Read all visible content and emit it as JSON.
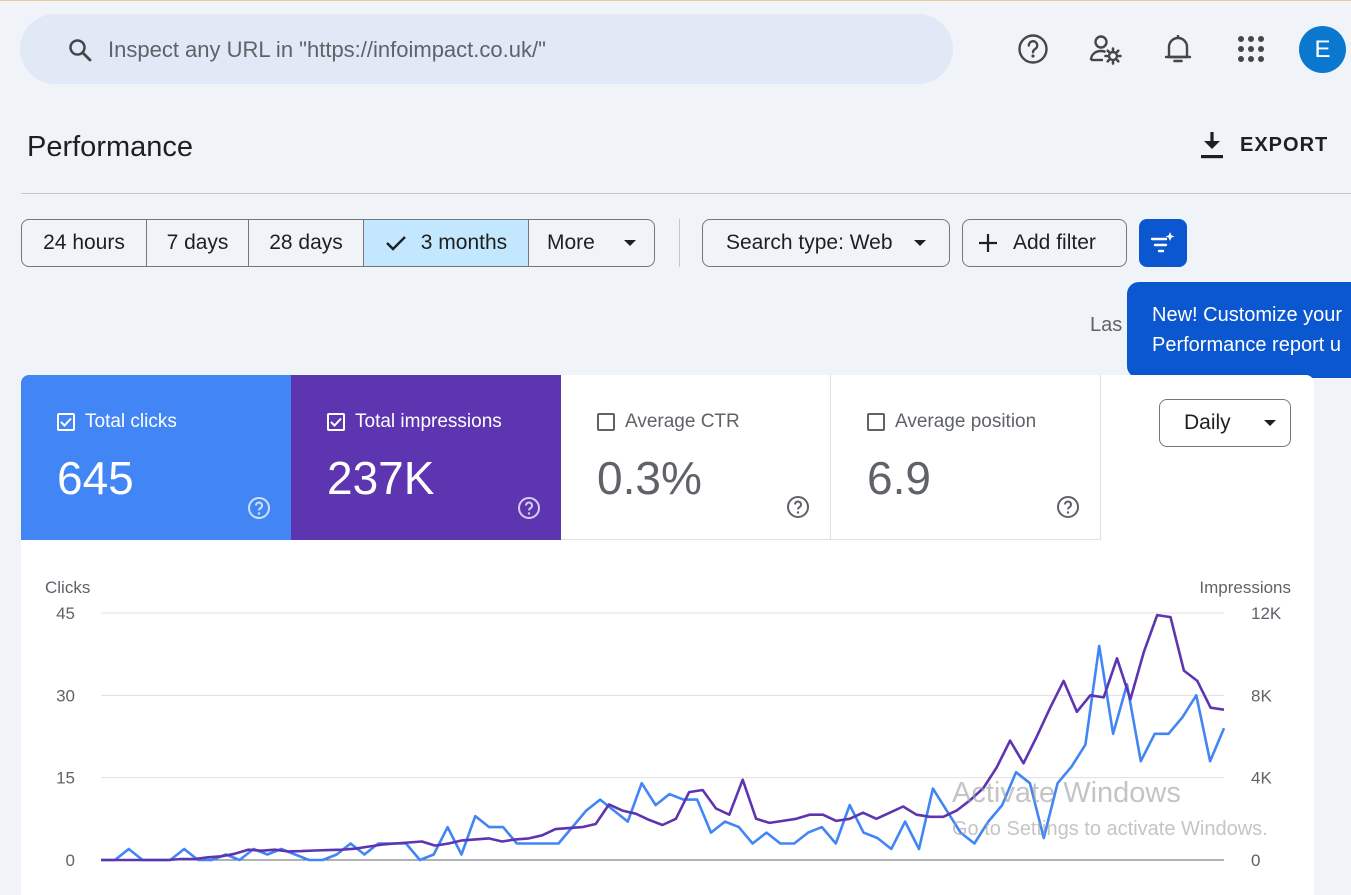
{
  "search": {
    "placeholder": "Inspect any URL in \"https://infoimpact.co.uk/\""
  },
  "header_icons": [
    "help-icon",
    "admin-settings-icon",
    "notifications-icon",
    "apps-icon"
  ],
  "avatar_letter": "E",
  "page": {
    "title": "Performance",
    "export_label": "EXPORT"
  },
  "date_ranges": [
    {
      "label": "24 hours",
      "selected": false
    },
    {
      "label": "7 days",
      "selected": false
    },
    {
      "label": "28 days",
      "selected": false
    },
    {
      "label": "3 months",
      "selected": true
    },
    {
      "label": "More",
      "selected": false
    }
  ],
  "filters": {
    "search_type": "Search type: Web",
    "add_filter": "Add filter"
  },
  "tooltip": {
    "line1": "New! Customize your",
    "line2": "Performance report u"
  },
  "last_updated_partial": "Las",
  "metrics": [
    {
      "label": "Total clicks",
      "value": "645",
      "checked": true,
      "color": "#4285f4"
    },
    {
      "label": "Total impressions",
      "value": "237K",
      "checked": true,
      "color": "#5e35b1"
    },
    {
      "label": "Average CTR",
      "value": "0.3%",
      "checked": false
    },
    {
      "label": "Average position",
      "value": "6.9",
      "checked": false
    }
  ],
  "granularity": "Daily",
  "watermark": {
    "line1": "Activate Windows",
    "line2": "Go to Settings to activate Windows."
  },
  "chart_data": {
    "type": "line",
    "left_axis_label": "Clicks",
    "right_axis_label": "Impressions",
    "left_ticks": [
      "45",
      "30",
      "15",
      "0"
    ],
    "right_ticks": [
      "12K",
      "8K",
      "4K",
      "0"
    ],
    "left_range": [
      0,
      45
    ],
    "right_range": [
      0,
      12000
    ],
    "grid": true,
    "series": [
      {
        "name": "Clicks",
        "color": "#4285f4",
        "axis": "left",
        "values": [
          0,
          0,
          2,
          0,
          0,
          0,
          2,
          0,
          0,
          1,
          0,
          2,
          1,
          2,
          1,
          0,
          0,
          1,
          3,
          1,
          3,
          3,
          3,
          0,
          1,
          6,
          1,
          8,
          6,
          6,
          3,
          3,
          3,
          3,
          6,
          9,
          11,
          9,
          7,
          14,
          10,
          12,
          11,
          11,
          5,
          7,
          6,
          3,
          5,
          3,
          3,
          5,
          6,
          3,
          10,
          5,
          4,
          2,
          7,
          2,
          13,
          9,
          5,
          3,
          7,
          10,
          16,
          14,
          4,
          14,
          17,
          21,
          39,
          23,
          32,
          18,
          23,
          23,
          26,
          30,
          18,
          24
        ]
      },
      {
        "name": "Impressions",
        "color": "#5e35b1",
        "axis": "right",
        "values": [
          0,
          0,
          0,
          0,
          0,
          0,
          50,
          50,
          130,
          180,
          300,
          500,
          450,
          500,
          420,
          430,
          460,
          480,
          500,
          550,
          650,
          750,
          800,
          850,
          900,
          700,
          800,
          950,
          1000,
          1050,
          900,
          1000,
          1050,
          1200,
          1500,
          1550,
          1600,
          1750,
          2700,
          2400,
          2250,
          1950,
          1700,
          2000,
          3300,
          3400,
          2500,
          2200,
          3900,
          2000,
          1800,
          1900,
          2000,
          2200,
          2200,
          1900,
          2000,
          2300,
          2000,
          2300,
          2600,
          2200,
          2100,
          2100,
          2400,
          2900,
          3500,
          4500,
          5800,
          4700,
          6000,
          7400,
          8700,
          7200,
          8000,
          7900,
          9800,
          7800,
          10100,
          11900,
          11800,
          9200,
          8700,
          7400,
          7300
        ]
      }
    ]
  }
}
